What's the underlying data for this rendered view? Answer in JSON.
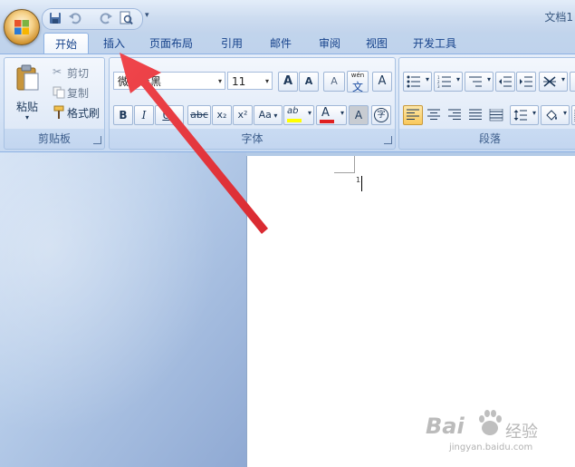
{
  "window": {
    "title": "文档1"
  },
  "quick_access": {
    "more": "▾",
    "items": [
      {
        "name": "save-icon"
      },
      {
        "name": "undo-icon"
      },
      {
        "name": "redo-icon"
      },
      {
        "name": "print-preview-icon"
      }
    ]
  },
  "tabs": [
    {
      "label": "开始",
      "active": true
    },
    {
      "label": "插入",
      "active": false
    },
    {
      "label": "页面布局",
      "active": false
    },
    {
      "label": "引用",
      "active": false
    },
    {
      "label": "邮件",
      "active": false
    },
    {
      "label": "审阅",
      "active": false
    },
    {
      "label": "视图",
      "active": false
    },
    {
      "label": "开发工具",
      "active": false
    }
  ],
  "clipboard": {
    "label": "剪贴板",
    "paste": "粘贴",
    "cut": "剪切",
    "copy": "复制",
    "format_painter": "格式刷"
  },
  "font": {
    "label": "字体",
    "family": "微软雅黑",
    "size": "11",
    "bold": "B",
    "italic": "I",
    "underline": "U",
    "strikethrough": "abc",
    "subscript": "x₂",
    "superscript": "x²",
    "change_case": "Aa",
    "highlight": "ab",
    "font_color": "A",
    "char_shading": "A",
    "enclose": "字",
    "grow": "A",
    "shrink": "A",
    "clear": "A",
    "phonetic": "wén",
    "phonetic_char": "文",
    "border": "A",
    "highlight_color": "#ffff00",
    "font_color_value": "#e02020"
  },
  "paragraph": {
    "label": "段落"
  },
  "document": {
    "page_number": "1"
  },
  "watermark": {
    "brand": "Bai",
    "chinese": "经验",
    "url": "jingyan.baidu.com"
  },
  "colors": {
    "accent": "#15428b",
    "arrow": "#e8353b"
  }
}
